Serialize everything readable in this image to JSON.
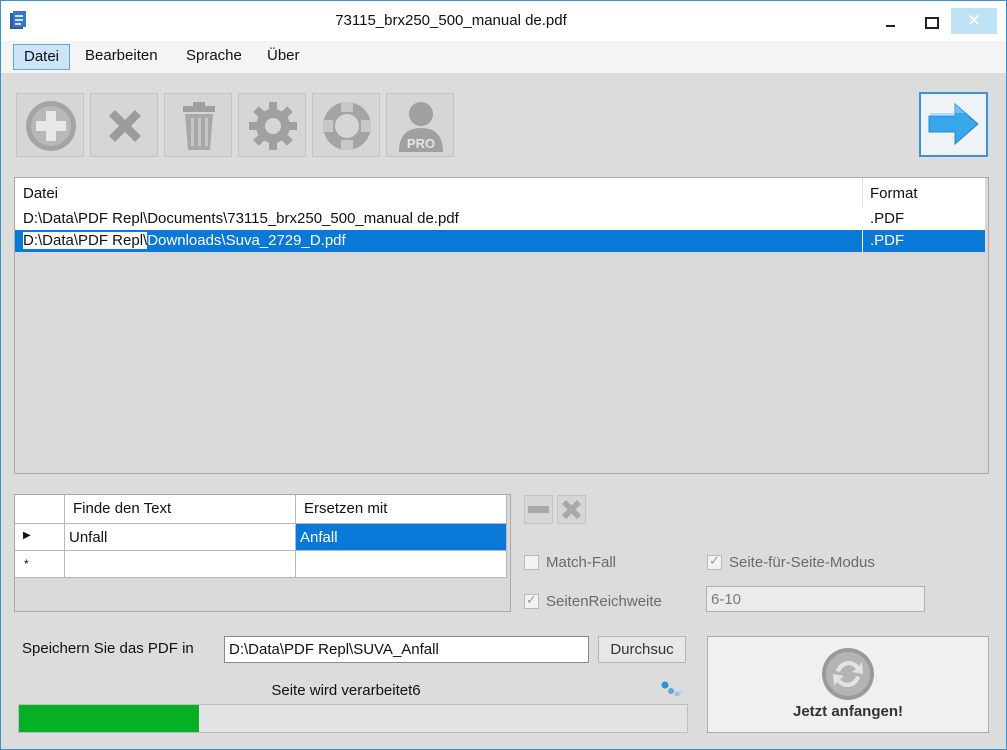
{
  "window": {
    "title": "73115_brx250_500_manual de.pdf"
  },
  "menu": [
    "Datei",
    "Bearbeiten",
    "Sprache",
    "Über"
  ],
  "toolbar": {
    "buttons": [
      "add-icon",
      "remove-icon",
      "trash-icon",
      "gear-icon",
      "lifebuoy-icon",
      "user-pro-icon"
    ],
    "pro_badge": "PRO",
    "go_button": "arrow-right-icon"
  },
  "file_list": {
    "columns": [
      "Datei",
      "Format"
    ],
    "rows": [
      {
        "path": "D:\\Data\\PDF Repl\\Documents\\73115_brx250_500_manual de.pdf",
        "format": ".PDF"
      },
      {
        "path_prefix": "D:\\Data\\PDF Repl\\",
        "path_rest": "Downloads\\Suva_2729_D.pdf",
        "format": ".PDF",
        "selected": true
      }
    ]
  },
  "replace_grid": {
    "columns": [
      "Finde den Text",
      "Ersetzen mit"
    ],
    "rows": [
      {
        "marker": "▶",
        "find": "Unfall",
        "replace": "Anfall"
      },
      {
        "marker": "*",
        "find": "",
        "replace": ""
      }
    ]
  },
  "options": {
    "match_case": "Match-Fall",
    "page_range": "SeitenReichweite",
    "page_by_page": "Seite-für-Seite-Modus",
    "range_value": "6-10"
  },
  "save": {
    "label": "Speichern Sie das PDF in",
    "path": "D:\\Data\\PDF Repl\\SUVA_Anfall",
    "browse": "Durchsuc"
  },
  "status": {
    "text": "Seite wird verarbeitet6",
    "progress": 0.27
  },
  "start": {
    "label": "Jetzt anfangen!"
  },
  "colors": {
    "accent": "#0a78d7",
    "progress": "#06b025",
    "go_arrow": "#3aa6ea"
  }
}
